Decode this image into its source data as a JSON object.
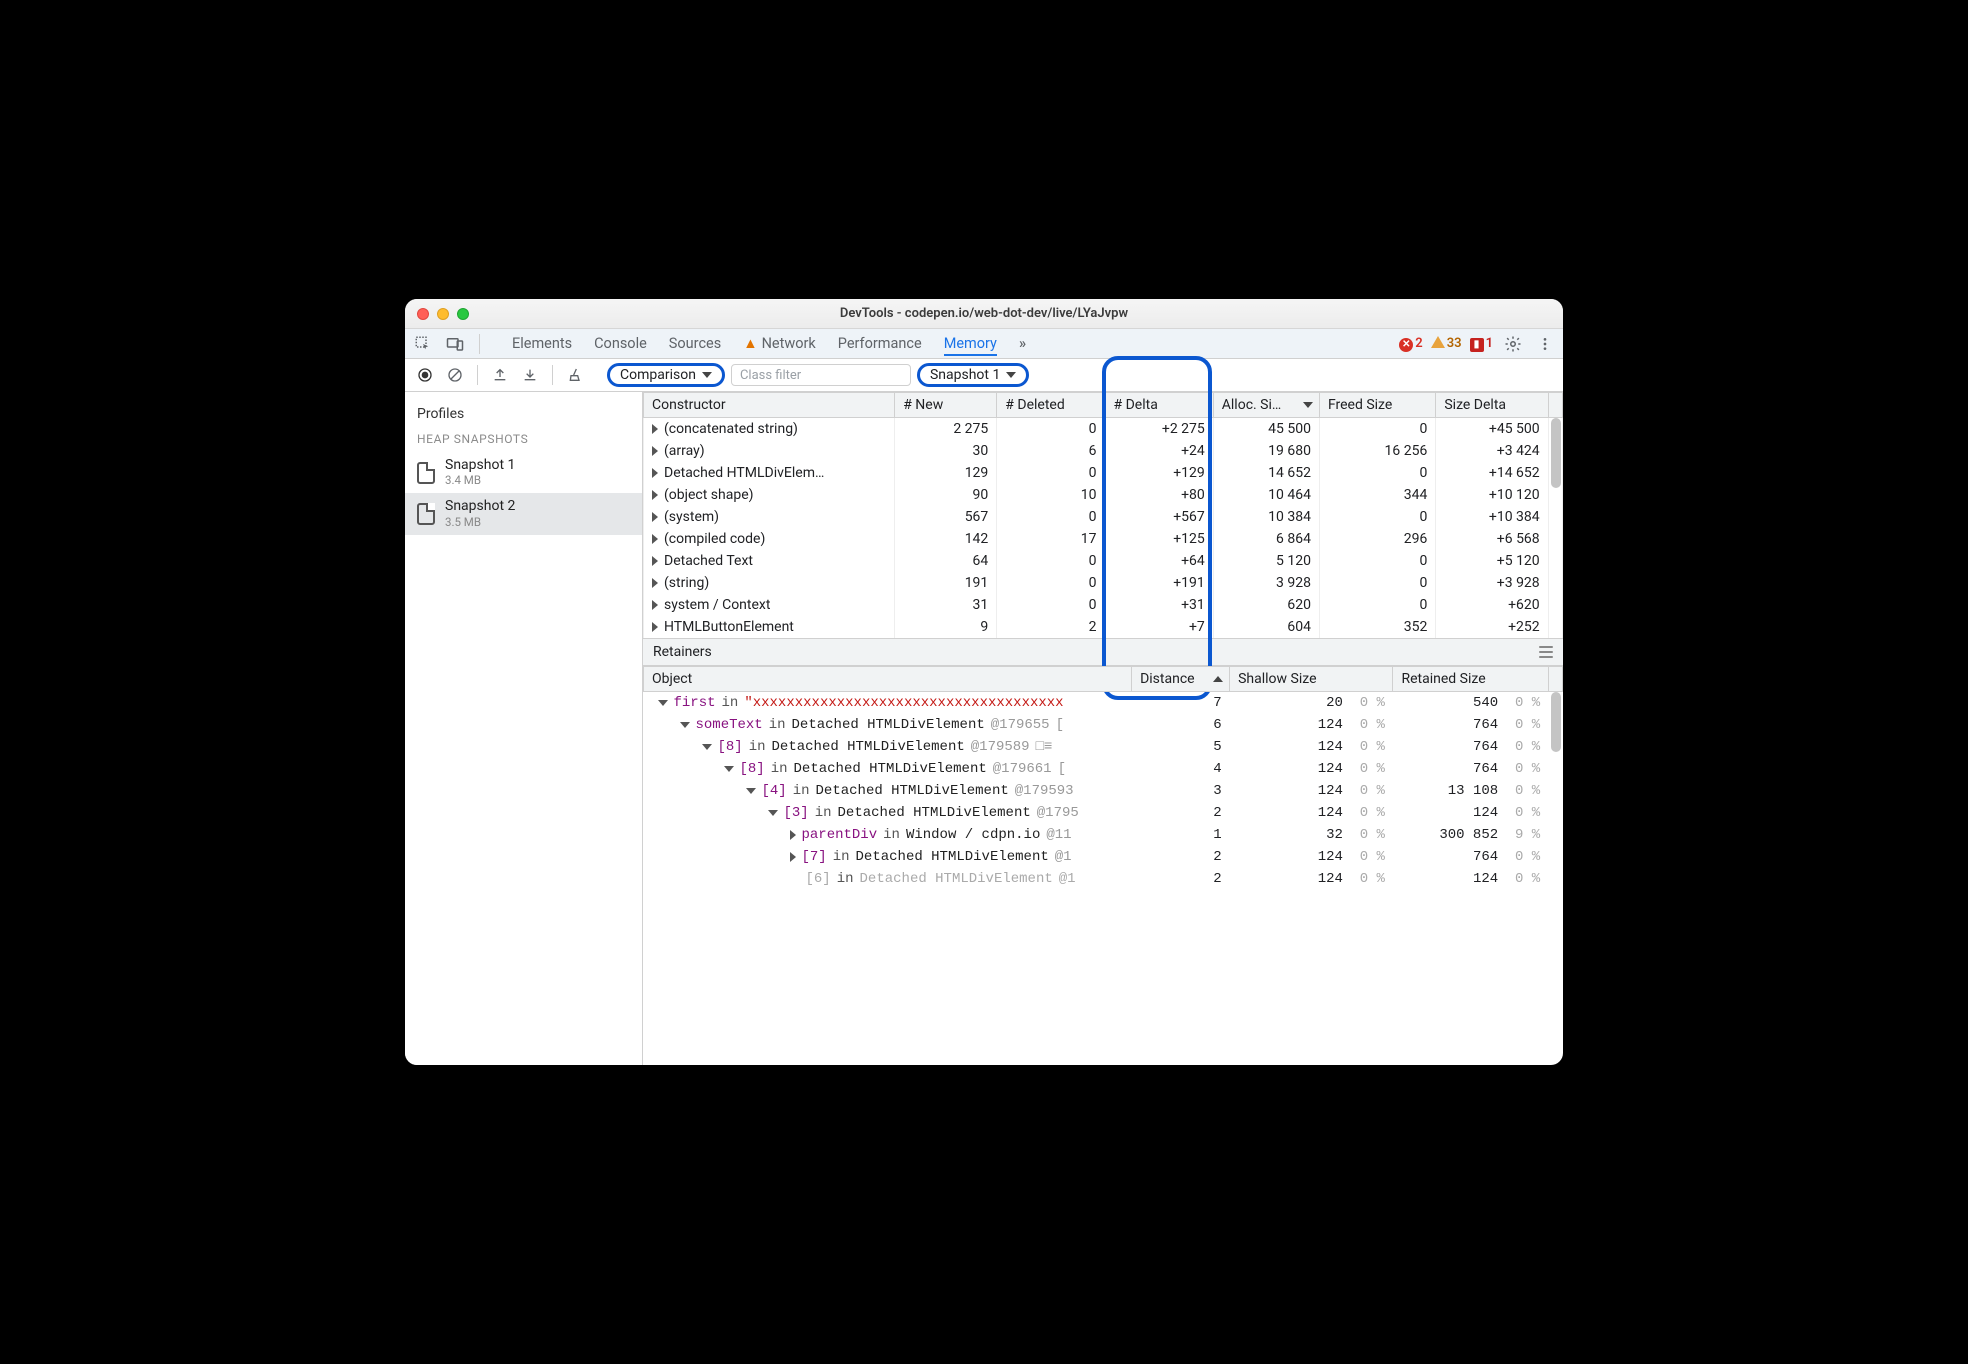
{
  "window": {
    "title": "DevTools - codepen.io/web-dot-dev/live/LYaJvpw"
  },
  "tabs": {
    "items": [
      "Elements",
      "Console",
      "Sources",
      "Network",
      "Performance",
      "Memory"
    ],
    "network_has_warning": true,
    "active": "Memory",
    "overflow": "»"
  },
  "status": {
    "errors": 2,
    "warnings": 33,
    "issues": 1
  },
  "toolbar": {
    "mode": "Comparison",
    "filter_placeholder": "Class filter",
    "baseline": "Snapshot 1"
  },
  "sidebar": {
    "title": "Profiles",
    "section": "HEAP SNAPSHOTS",
    "snapshots": [
      {
        "name": "Snapshot 1",
        "size": "3.4 MB",
        "selected": false
      },
      {
        "name": "Snapshot 2",
        "size": "3.5 MB",
        "selected": true
      }
    ]
  },
  "grid": {
    "columns": [
      "Constructor",
      "# New",
      "# Deleted",
      "# Delta",
      "Alloc. Si…",
      "Freed Size",
      "Size Delta"
    ],
    "sort_col": 4,
    "sort_dir": "desc",
    "rows": [
      {
        "name": "(concatenated string)",
        "new": "2 275",
        "del": "0",
        "delta": "+2 275",
        "alloc": "45 500",
        "freed": "0",
        "sdelta": "+45 500"
      },
      {
        "name": "(array)",
        "new": "30",
        "del": "6",
        "delta": "+24",
        "alloc": "19 680",
        "freed": "16 256",
        "sdelta": "+3 424"
      },
      {
        "name": "Detached HTMLDivElem…",
        "new": "129",
        "del": "0",
        "delta": "+129",
        "alloc": "14 652",
        "freed": "0",
        "sdelta": "+14 652"
      },
      {
        "name": "(object shape)",
        "new": "90",
        "del": "10",
        "delta": "+80",
        "alloc": "10 464",
        "freed": "344",
        "sdelta": "+10 120"
      },
      {
        "name": "(system)",
        "new": "567",
        "del": "0",
        "delta": "+567",
        "alloc": "10 384",
        "freed": "0",
        "sdelta": "+10 384"
      },
      {
        "name": "(compiled code)",
        "new": "142",
        "del": "17",
        "delta": "+125",
        "alloc": "6 864",
        "freed": "296",
        "sdelta": "+6 568"
      },
      {
        "name": "Detached Text",
        "new": "64",
        "del": "0",
        "delta": "+64",
        "alloc": "5 120",
        "freed": "0",
        "sdelta": "+5 120"
      },
      {
        "name": "(string)",
        "new": "191",
        "del": "0",
        "delta": "+191",
        "alloc": "3 928",
        "freed": "0",
        "sdelta": "+3 928"
      },
      {
        "name": "system / Context",
        "new": "31",
        "del": "0",
        "delta": "+31",
        "alloc": "620",
        "freed": "0",
        "sdelta": "+620"
      },
      {
        "name": "HTMLButtonElement",
        "new": "9",
        "del": "2",
        "delta": "+7",
        "alloc": "604",
        "freed": "352",
        "sdelta": "+252"
      }
    ]
  },
  "retainers": {
    "label": "Retainers",
    "columns": [
      "Object",
      "Distance",
      "Shallow Size",
      "Retained Size"
    ],
    "sort_col": 1,
    "sort_dir": "asc",
    "rows": [
      {
        "indent": 0,
        "open": true,
        "prop": "first",
        "in": true,
        "str": "\"xxxxxxxxxxxxxxxxxxxxxxxxxxxxxxxxxxxxx",
        "dist": "7",
        "ss": "20",
        "sp": "0 %",
        "rs": "540",
        "rp": "0 %"
      },
      {
        "indent": 1,
        "open": true,
        "prop": "someText",
        "in": true,
        "type": "Detached HTMLDivElement",
        "id": "@179655",
        "extra": " [",
        "dist": "6",
        "ss": "124",
        "sp": "0 %",
        "rs": "764",
        "rp": "0 %"
      },
      {
        "indent": 2,
        "open": true,
        "prop": "[8]",
        "in": true,
        "type": "Detached HTMLDivElement",
        "id": "@179589",
        "extra": " □≡",
        "dist": "5",
        "ss": "124",
        "sp": "0 %",
        "rs": "764",
        "rp": "0 %"
      },
      {
        "indent": 3,
        "open": true,
        "prop": "[8]",
        "in": true,
        "type": "Detached HTMLDivElement",
        "id": "@179661",
        "extra": " [",
        "dist": "4",
        "ss": "124",
        "sp": "0 %",
        "rs": "764",
        "rp": "0 %"
      },
      {
        "indent": 4,
        "open": true,
        "prop": "[4]",
        "in": true,
        "type": "Detached HTMLDivElement",
        "id": "@179593",
        "dist": "3",
        "ss": "124",
        "sp": "0 %",
        "rs": "13 108",
        "rp": "0 %"
      },
      {
        "indent": 5,
        "open": true,
        "prop": "[3]",
        "in": true,
        "type": "Detached HTMLDivElement",
        "id": "@1795",
        "dist": "2",
        "ss": "124",
        "sp": "0 %",
        "rs": "124",
        "rp": "0 %"
      },
      {
        "indent": 6,
        "open": false,
        "prop": "parentDiv",
        "in": true,
        "type": "Window / cdpn.io",
        "id": "@11",
        "dist": "1",
        "ss": "32",
        "sp": "0 %",
        "rs": "300 852",
        "rp": "9 %"
      },
      {
        "indent": 6,
        "open": false,
        "prop": "[7]",
        "in": true,
        "type": "Detached HTMLDivElement",
        "id": "@1",
        "dist": "2",
        "ss": "124",
        "sp": "0 %",
        "rs": "764",
        "rp": "0 %"
      },
      {
        "indent": 6,
        "faded": true,
        "prop": "[6]",
        "in": true,
        "type": "Detached HTMLDivElement",
        "id": "@1",
        "dist": "2",
        "ss": "124",
        "sp": "0 %",
        "rs": "124",
        "rp": "0 %"
      }
    ]
  }
}
